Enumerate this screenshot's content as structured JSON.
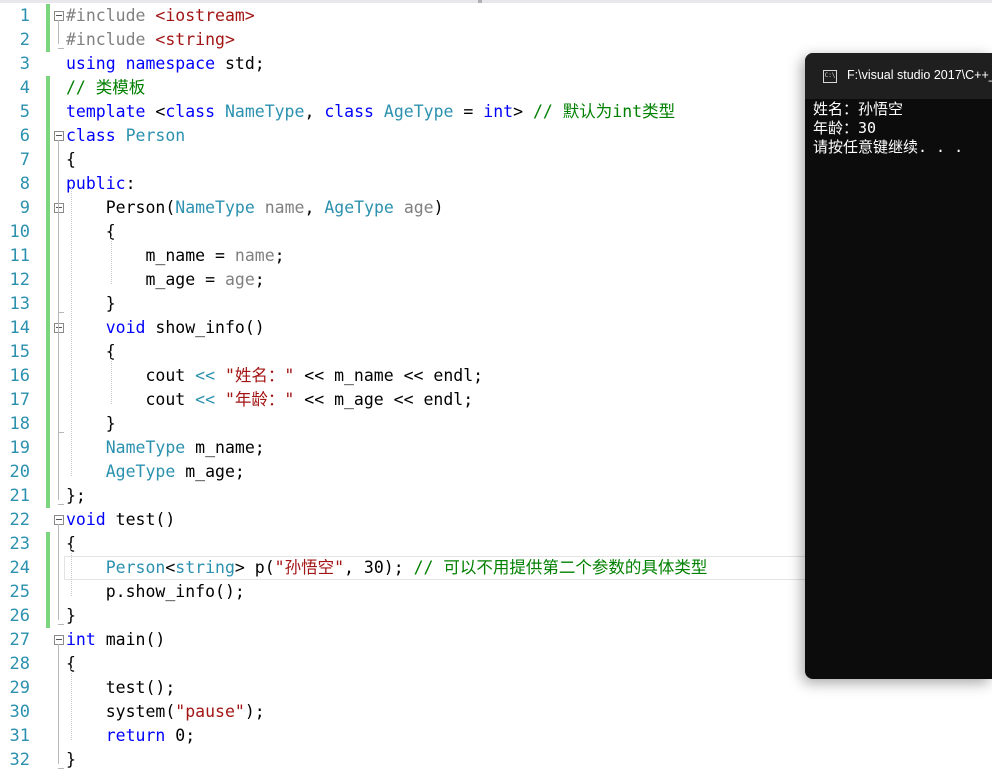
{
  "editor": {
    "lines": [
      {
        "num": "1",
        "tokens": [
          {
            "t": "#include ",
            "c": "pp"
          },
          {
            "t": "<iostream>",
            "c": "str"
          }
        ]
      },
      {
        "num": "2",
        "tokens": [
          {
            "t": "#include ",
            "c": "pp"
          },
          {
            "t": "<string>",
            "c": "str"
          }
        ]
      },
      {
        "num": "3",
        "tokens": [
          {
            "t": "using ",
            "c": "kw"
          },
          {
            "t": "namespace ",
            "c": "kw"
          },
          {
            "t": "std;",
            "c": ""
          }
        ]
      },
      {
        "num": "4",
        "tokens": [
          {
            "t": "// 类模板",
            "c": "cm"
          }
        ]
      },
      {
        "num": "5",
        "tokens": [
          {
            "t": "template ",
            "c": "kw"
          },
          {
            "t": "<",
            "c": ""
          },
          {
            "t": "class ",
            "c": "kw"
          },
          {
            "t": "NameType",
            "c": "ty"
          },
          {
            "t": ", ",
            "c": ""
          },
          {
            "t": "class ",
            "c": "kw"
          },
          {
            "t": "AgeType",
            "c": "ty"
          },
          {
            "t": " = ",
            "c": ""
          },
          {
            "t": "int",
            "c": "kw"
          },
          {
            "t": "> ",
            "c": ""
          },
          {
            "t": "// 默认为int类型",
            "c": "cm"
          }
        ]
      },
      {
        "num": "6",
        "tokens": [
          {
            "t": "class ",
            "c": "kw"
          },
          {
            "t": "Person",
            "c": "ty"
          }
        ]
      },
      {
        "num": "7",
        "tokens": [
          {
            "t": "{",
            "c": ""
          }
        ]
      },
      {
        "num": "8",
        "tokens": [
          {
            "t": "public",
            "c": "kw"
          },
          {
            "t": ":",
            "c": ""
          }
        ]
      },
      {
        "num": "9",
        "tokens": [
          {
            "t": "    Person",
            "c": ""
          },
          {
            "t": "(",
            "c": ""
          },
          {
            "t": "NameType",
            "c": "ty"
          },
          {
            "t": " ",
            "c": ""
          },
          {
            "t": "name",
            "c": "pa"
          },
          {
            "t": ", ",
            "c": ""
          },
          {
            "t": "AgeType",
            "c": "ty"
          },
          {
            "t": " ",
            "c": ""
          },
          {
            "t": "age",
            "c": "pa"
          },
          {
            "t": ")",
            "c": ""
          }
        ]
      },
      {
        "num": "10",
        "tokens": [
          {
            "t": "    {",
            "c": ""
          }
        ]
      },
      {
        "num": "11",
        "tokens": [
          {
            "t": "        m_name = ",
            "c": ""
          },
          {
            "t": "name",
            "c": "pa"
          },
          {
            "t": ";",
            "c": ""
          }
        ]
      },
      {
        "num": "12",
        "tokens": [
          {
            "t": "        m_age = ",
            "c": ""
          },
          {
            "t": "age",
            "c": "pa"
          },
          {
            "t": ";",
            "c": ""
          }
        ]
      },
      {
        "num": "13",
        "tokens": [
          {
            "t": "    }",
            "c": ""
          }
        ]
      },
      {
        "num": "14",
        "tokens": [
          {
            "t": "    ",
            "c": ""
          },
          {
            "t": "void",
            "c": "kw"
          },
          {
            "t": " show_info()",
            "c": ""
          }
        ]
      },
      {
        "num": "15",
        "tokens": [
          {
            "t": "    {",
            "c": ""
          }
        ]
      },
      {
        "num": "16",
        "tokens": [
          {
            "t": "        cout ",
            "c": ""
          },
          {
            "t": "<<",
            "c": "ty"
          },
          {
            "t": " ",
            "c": ""
          },
          {
            "t": "\"姓名：\"",
            "c": "str"
          },
          {
            "t": " << m_name << endl;",
            "c": ""
          }
        ]
      },
      {
        "num": "17",
        "tokens": [
          {
            "t": "        cout ",
            "c": ""
          },
          {
            "t": "<<",
            "c": "ty"
          },
          {
            "t": " ",
            "c": ""
          },
          {
            "t": "\"年龄：\"",
            "c": "str"
          },
          {
            "t": " << m_age << endl;",
            "c": ""
          }
        ]
      },
      {
        "num": "18",
        "tokens": [
          {
            "t": "    }",
            "c": ""
          }
        ]
      },
      {
        "num": "19",
        "tokens": [
          {
            "t": "    ",
            "c": ""
          },
          {
            "t": "NameType",
            "c": "ty"
          },
          {
            "t": " m_name;",
            "c": ""
          }
        ]
      },
      {
        "num": "20",
        "tokens": [
          {
            "t": "    ",
            "c": ""
          },
          {
            "t": "AgeType",
            "c": "ty"
          },
          {
            "t": " m_age;",
            "c": ""
          }
        ]
      },
      {
        "num": "21",
        "tokens": [
          {
            "t": "};",
            "c": ""
          }
        ]
      },
      {
        "num": "22",
        "tokens": [
          {
            "t": "void",
            "c": "kw"
          },
          {
            "t": " test()",
            "c": ""
          }
        ]
      },
      {
        "num": "23",
        "tokens": [
          {
            "t": "{",
            "c": ""
          }
        ]
      },
      {
        "num": "24",
        "tokens": [
          {
            "t": "    ",
            "c": ""
          },
          {
            "t": "Person",
            "c": "ty"
          },
          {
            "t": "<",
            "c": ""
          },
          {
            "t": "string",
            "c": "ty"
          },
          {
            "t": "> p(",
            "c": ""
          },
          {
            "t": "\"孙悟空\"",
            "c": "str"
          },
          {
            "t": ", 30); ",
            "c": ""
          },
          {
            "t": "// 可以不用提供第二个参数的具体类型",
            "c": "cm"
          }
        ]
      },
      {
        "num": "25",
        "tokens": [
          {
            "t": "    p.show_info();",
            "c": ""
          }
        ]
      },
      {
        "num": "26",
        "tokens": [
          {
            "t": "}",
            "c": ""
          }
        ]
      },
      {
        "num": "27",
        "tokens": [
          {
            "t": "int",
            "c": "kw"
          },
          {
            "t": " main()",
            "c": ""
          }
        ]
      },
      {
        "num": "28",
        "tokens": [
          {
            "t": "{",
            "c": ""
          }
        ]
      },
      {
        "num": "29",
        "tokens": [
          {
            "t": "    test();",
            "c": ""
          }
        ]
      },
      {
        "num": "30",
        "tokens": [
          {
            "t": "    system(",
            "c": ""
          },
          {
            "t": "\"pause\"",
            "c": "str"
          },
          {
            "t": ");",
            "c": ""
          }
        ]
      },
      {
        "num": "31",
        "tokens": [
          {
            "t": "    ",
            "c": ""
          },
          {
            "t": "return",
            "c": "kw"
          },
          {
            "t": " 0;",
            "c": ""
          }
        ]
      },
      {
        "num": "32",
        "tokens": [
          {
            "t": "}",
            "c": ""
          }
        ]
      }
    ]
  },
  "console": {
    "icon_label": "C:\\",
    "title": "F:\\visual studio 2017\\C++_",
    "lines": [
      "姓名：孙悟空",
      "年龄：30",
      "请按任意键继续. . ."
    ]
  }
}
